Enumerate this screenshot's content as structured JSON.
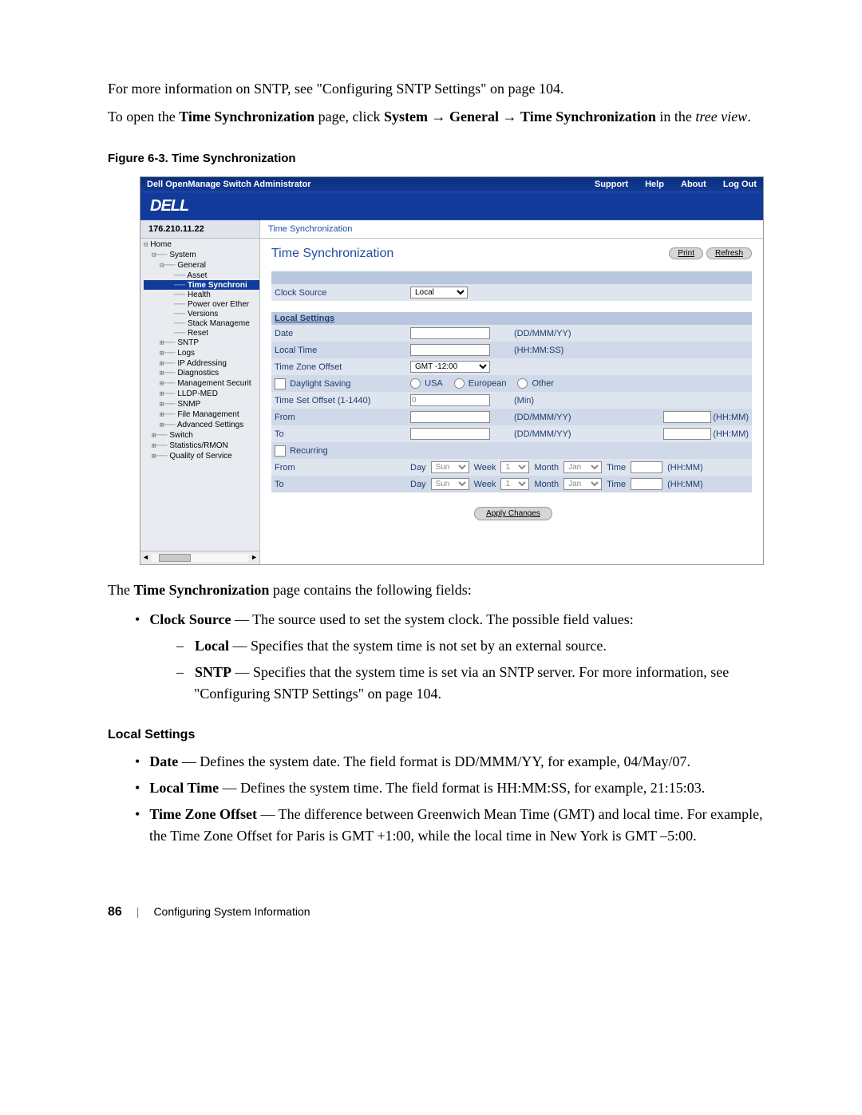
{
  "intro": {
    "p1_a": "For more information on SNTP, see \"Configuring SNTP Settings\" on page 104.",
    "p2_a": "To open the ",
    "p2_b": "Time Synchronization",
    "p2_c": " page, click ",
    "p2_d": "System ",
    "p2_e": "→ ",
    "p2_f": "General",
    "p2_g": " → ",
    "p2_h": "Time Synchronization",
    "p2_i": " in the ",
    "p2_j": "tree view",
    "p2_k": "."
  },
  "fig_caption": "Figure 6-3.    Time Synchronization",
  "screenshot": {
    "app_title": "Dell OpenManage Switch Administrator",
    "menu": {
      "support": "Support",
      "help": "Help",
      "about": "About",
      "logout": "Log Out"
    },
    "logo_text": "DELL",
    "ip": "176.210.11.22",
    "breadcrumb": "Time Synchronization",
    "tree": {
      "home": "Home",
      "system": "System",
      "general": "General",
      "asset": "Asset",
      "time_sync": "Time Synchroni",
      "health": "Health",
      "poe": "Power over Ether",
      "versions": "Versions",
      "stack": "Stack Manageme",
      "reset": "Reset",
      "sntp": "SNTP",
      "logs": "Logs",
      "ip": "IP Addressing",
      "diag": "Diagnostics",
      "msec": "Management Securit",
      "lldp": "LLDP-MED",
      "snmp": "SNMP",
      "file": "File Management",
      "adv": "Advanced Settings",
      "switch": "Switch",
      "stats": "Statistics/RMON",
      "qos": "Quality of Service"
    },
    "content": {
      "title": "Time Synchronization",
      "print": "Print",
      "refresh": "Refresh",
      "clock_source_lbl": "Clock Source",
      "clock_source_val": "Local",
      "local_settings_hdr": "Local Settings",
      "date_lbl": "Date",
      "date_hint": "(DD/MMM/YY)",
      "localtime_lbl": "Local Time",
      "localtime_hint": "(HH:MM:SS)",
      "tz_lbl": "Time Zone Offset",
      "tz_val": "GMT -12:00",
      "dls_lbl": "Daylight Saving",
      "dls_usa": "USA",
      "dls_eu": "European",
      "dls_other": "Other",
      "tset_lbl": "Time Set Offset (1-1440)",
      "tset_hint": "(Min)",
      "from_lbl": "From",
      "to_lbl": "To",
      "ddmmyy": "(DD/MMM/YY)",
      "hhmm": "(HH:MM)",
      "recurring_lbl": "Recurring",
      "day_lbl": "Day",
      "day_val": "Sun",
      "week_lbl": "Week",
      "week_val": "1",
      "month_lbl": "Month",
      "month_val": "Jan",
      "time_lbl": "Time",
      "apply": "Apply Changes"
    }
  },
  "after": {
    "intro_a": "The ",
    "intro_b": "Time Synchronization",
    "intro_c": " page contains the following fields:",
    "cs_b": "Clock Source",
    "cs_t": " — The source used to set the system clock. The possible field values:",
    "local_b": "Local",
    "local_t": " — Specifies that the system time is not set by an external source.",
    "sntp_b": "SNTP",
    "sntp_t": " — Specifies that the system time is set via an SNTP server. For more information, see \"Configuring SNTP Settings\" on page 104.",
    "ls_hdr": "Local Settings",
    "date_b": "Date",
    "date_t": " — Defines the system date. The field format is DD/MMM/YY, for example, 04/May/07.",
    "lt_b": "Local Time",
    "lt_t": " — Defines the system time. The field format is HH:MM:SS, for example, 21:15:03.",
    "tz_b": "Time Zone Offset",
    "tz_t": " — The difference between Greenwich Mean Time (GMT) and local time. For example, the Time Zone Offset for Paris is GMT +1:00, while the local time in New York is GMT –5:00."
  },
  "footer": {
    "page": "86",
    "section": "Configuring System Information"
  }
}
